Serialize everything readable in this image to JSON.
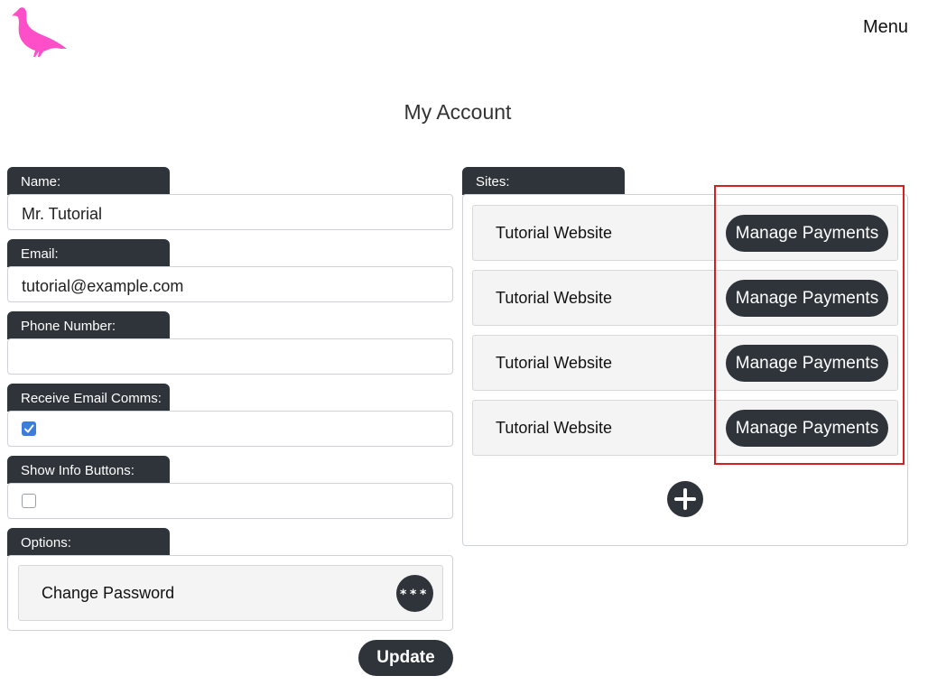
{
  "header": {
    "logo_icon": "pigeon-logo",
    "logo_color": "#ff4fc8",
    "menu_label": "Menu"
  },
  "page": {
    "title": "My Account"
  },
  "account_form": {
    "name": {
      "label": "Name:",
      "value": "Mr. Tutorial"
    },
    "email": {
      "label": "Email:",
      "value": "tutorial@example.com"
    },
    "phone": {
      "label": "Phone Number:",
      "value": ""
    },
    "receive_email_comms": {
      "label": "Receive Email Comms:",
      "checked": true
    },
    "show_info_buttons": {
      "label": "Show Info Buttons:",
      "checked": false
    },
    "options": {
      "label": "Options:",
      "items": [
        {
          "label": "Change Password",
          "icon": "asterisks-icon"
        }
      ]
    },
    "update_label": "Update"
  },
  "sites": {
    "label": "Sites:",
    "items": [
      {
        "name": "Tutorial Website",
        "action_label": "Manage Payments"
      },
      {
        "name": "Tutorial Website",
        "action_label": "Manage Payments"
      },
      {
        "name": "Tutorial Website",
        "action_label": "Manage Payments"
      },
      {
        "name": "Tutorial Website",
        "action_label": "Manage Payments"
      }
    ],
    "add_icon": "plus-icon"
  },
  "colors": {
    "dark": "#2f343a",
    "checkbox_checked": "#3b7ddd",
    "highlight": "#d42020"
  }
}
